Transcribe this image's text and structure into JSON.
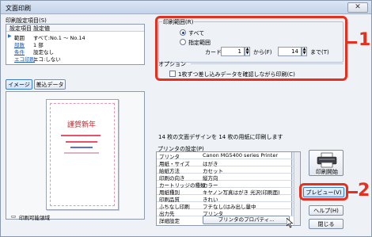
{
  "window": {
    "title": "文面印刷",
    "close_glyph": "✕"
  },
  "settings_list": {
    "label": "印刷設定項目(S)",
    "col1": "設定項目",
    "col2": "設定値",
    "rows": [
      {
        "key": "範囲",
        "value": "すべて:No.1 〜 No.14"
      },
      {
        "key": "部数",
        "value": "1 部"
      },
      {
        "key": "条件",
        "value": "設定なし"
      },
      {
        "key": "エコ印刷",
        "value": "エコ:しない"
      }
    ]
  },
  "print_range": {
    "group_label": "印刷範囲(R)",
    "all_label": "すべて",
    "specified_label": "指定範囲",
    "card_label": "カード",
    "from_value": "1",
    "from_label": "から(F)",
    "to_value": "14",
    "to_label": "まで(T)"
  },
  "options": {
    "group_label": "オプション",
    "confirm_label": "1枚ずつ差し込みデータを確認しながら印刷(C)"
  },
  "preview_tabs": {
    "image": "イメージ",
    "merge": "差込データ"
  },
  "preview": {
    "card_text": "謹賀新年",
    "caption": "印刷可能領域"
  },
  "info_text": "14 枚の文面デザインを 14 枚の用紙に印刷します",
  "printer_settings": {
    "label": "プリンタの設定(P)",
    "rows": [
      {
        "key": "プリンタ",
        "value": "Canon MG5400 series Printer"
      },
      {
        "key": "用紙・サイズ",
        "value": "はがき"
      },
      {
        "key": "給紙方法",
        "value": "カセット"
      },
      {
        "key": "印刷の向き",
        "value": "縦方向"
      },
      {
        "key": "カートリッジの種類",
        "value": "カラー"
      },
      {
        "key": "用紙種別",
        "value": "キヤノン写真はがき 光沢(印刷面)"
      },
      {
        "key": "印刷品質",
        "value": "きれい"
      },
      {
        "key": "ふちなし印刷",
        "value": "フチなし(はみ出し量中"
      },
      {
        "key": "出力先",
        "value": "プリンタ"
      },
      {
        "key": "詳細設定",
        "value": "プリンタのプロパティ..."
      }
    ]
  },
  "buttons": {
    "print_start": "印刷開始",
    "preview": "プレビュー(V)",
    "help": "ヘルプ(H)",
    "close": "閉じる"
  },
  "callouts": {
    "one": "1",
    "two": "2"
  },
  "colors": {
    "accent_red": "#e53020",
    "selection_blue": "#3a7bd5"
  }
}
